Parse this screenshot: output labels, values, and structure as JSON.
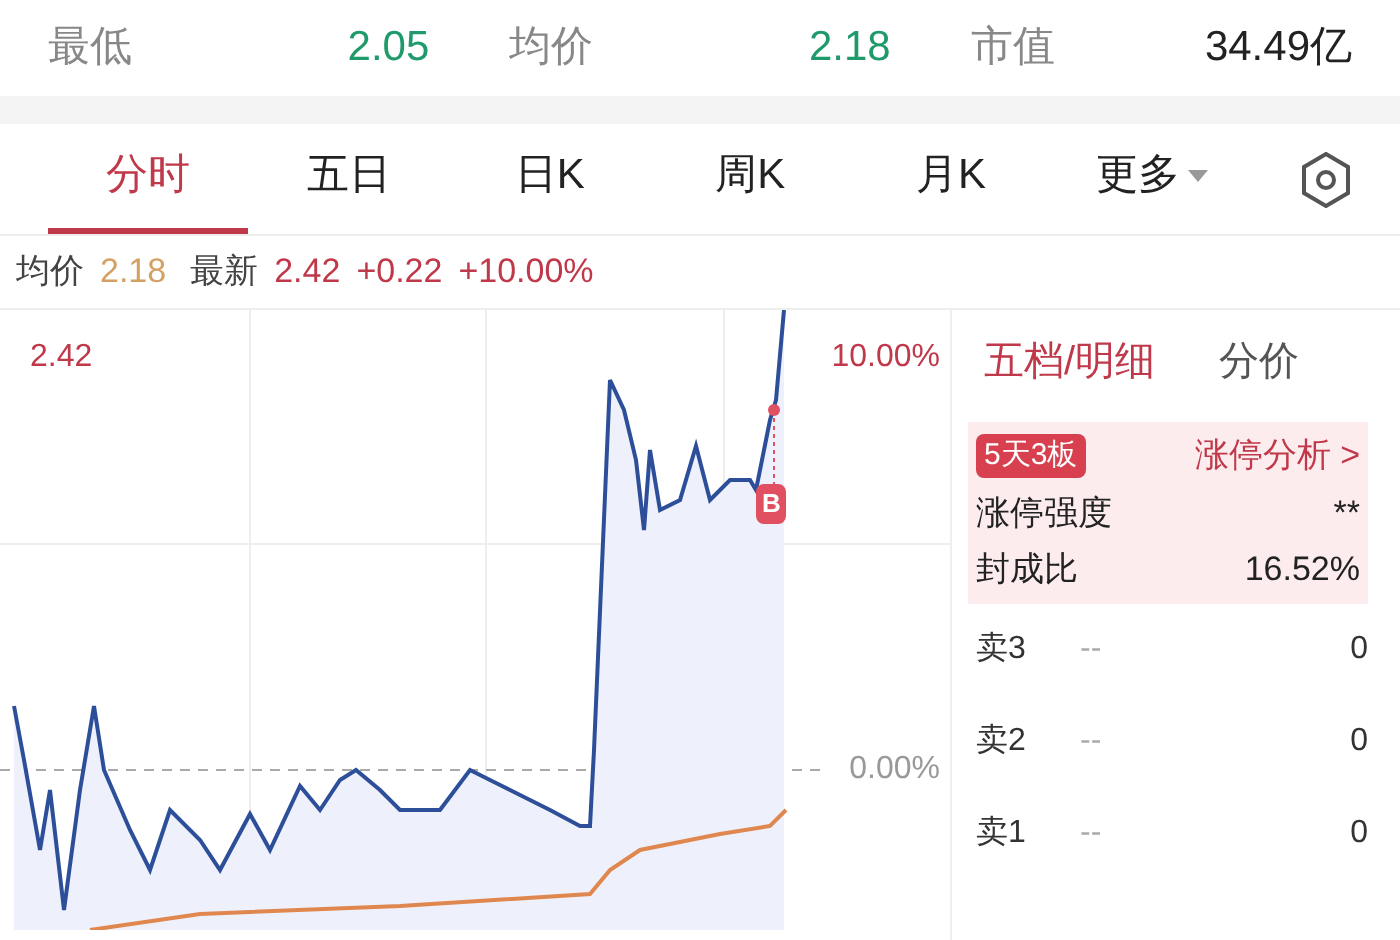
{
  "stats": [
    {
      "label": "最低",
      "value": "2.05",
      "color": "#1f9a6a"
    },
    {
      "label": "均价",
      "value": "2.18",
      "color": "#1f9a6a"
    },
    {
      "label": "市值",
      "value": "34.49亿",
      "color": "#222222"
    }
  ],
  "tabs": [
    {
      "label": "分时",
      "selected": true
    },
    {
      "label": "五日",
      "selected": false
    },
    {
      "label": "日K",
      "selected": false
    },
    {
      "label": "周K",
      "selected": false
    },
    {
      "label": "月K",
      "selected": false
    },
    {
      "label": "更多",
      "selected": false,
      "kind": "dropdown"
    }
  ],
  "info_line": [
    {
      "label": "均价",
      "values": [
        {
          "text": "2.18",
          "color": "#d4a064"
        }
      ]
    },
    {
      "label": "最新",
      "values": [
        {
          "text": "2.42",
          "color": "#c0394a"
        },
        {
          "text": "+0.22",
          "color": "#c0394a"
        },
        {
          "text": "+10.00%",
          "color": "#c0394a"
        }
      ]
    }
  ],
  "chart": {
    "marker": "B",
    "top_price": "2.42",
    "top_pct": "10.00%",
    "base_pct": "0.00%"
  },
  "panel": {
    "tabs": [
      {
        "label": "五档/明细",
        "selected": true
      },
      {
        "label": "分价",
        "selected": false
      }
    ],
    "limit_up": {
      "badge": "5天3板",
      "link": "涨停分析 >",
      "rows": [
        {
          "label": "涨停强度",
          "value": "**"
        },
        {
          "label": "封成比",
          "value": "16.52%"
        }
      ]
    },
    "orders": [
      {
        "label": "卖3",
        "price": "--",
        "volume": "0"
      },
      {
        "label": "卖2",
        "price": "--",
        "volume": "0"
      },
      {
        "label": "卖1",
        "price": "--",
        "volume": "0"
      }
    ]
  }
}
